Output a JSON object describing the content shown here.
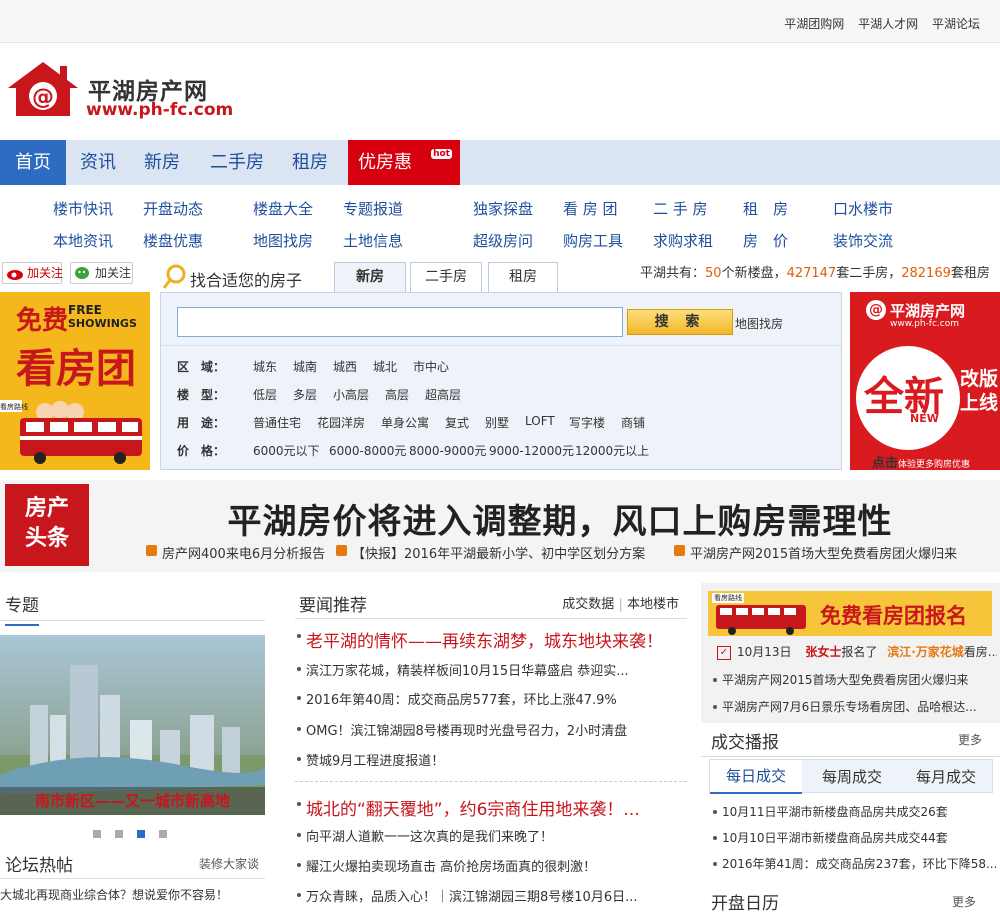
{
  "top_links": [
    "平湖团购网",
    "平湖人才网",
    "平湖论坛"
  ],
  "logo": {
    "name": "平湖房产网",
    "url": "www.ph-fc.com"
  },
  "nav": {
    "items": [
      "首页",
      "资讯",
      "新房",
      "二手房",
      "租房",
      "优房惠"
    ],
    "hot_badge": "hot"
  },
  "subnav": {
    "row1": [
      "楼市快讯",
      "开盘动态",
      "楼盘大全",
      "专题报道",
      "独家探盘",
      "看 房 团",
      "二 手 房",
      "租　房",
      "口水楼市"
    ],
    "row2": [
      "本地资讯",
      "楼盘优惠",
      "地图找房",
      "土地信息",
      "超级房问",
      "购房工具",
      "求购求租",
      "房　价",
      "装饰交流"
    ]
  },
  "social": {
    "weibo": "加关注",
    "wechat": "加关注"
  },
  "search": {
    "title": "找合适您的房子",
    "tabs": [
      "新房",
      "二手房",
      "租房"
    ],
    "button": "搜 索",
    "map_link": "地图找房",
    "placeholder": "",
    "filters": [
      {
        "label": "区　域：",
        "options": [
          "城东",
          "城南",
          "城西",
          "城北",
          "市中心"
        ]
      },
      {
        "label": "楼　型：",
        "options": [
          "低层",
          "多层",
          "小高层",
          "高层",
          "超高层"
        ]
      },
      {
        "label": "用　途：",
        "options": [
          "普通住宅",
          "花园洋房",
          "单身公寓",
          "复式",
          "别墅",
          "LOFT",
          "写字楼",
          "商铺"
        ]
      },
      {
        "label": "价　格：",
        "options": [
          "6000元以下",
          "6000-8000元",
          "8000-9000元",
          "9000-12000元",
          "12000元以上"
        ]
      }
    ]
  },
  "stats": {
    "prefix": "平湖共有：",
    "new_count": "50",
    "new_label": "个新楼盘，",
    "second_count": "427147",
    "second_label": "套二手房，",
    "rent_count": "282169",
    "rent_label": "套租房"
  },
  "left_ad": {
    "free": "免费",
    "free_en1": "FREE",
    "free_en2": "SHOWINGS",
    "title": "看房团",
    "sign": "看房路线"
  },
  "right_ad": {
    "brand": "平湖房产网",
    "url": "www.ph-fc.com",
    "new": "全新",
    "new_en": "NEW",
    "tag1": "改版",
    "tag2": "上线",
    "bottom_bold": "点击",
    "bottom": "体验更多购房优惠"
  },
  "headline": {
    "badge1": "房产",
    "badge2": "头条",
    "title": "平湖房价将进入调整期，风口上购房需理性",
    "links": [
      "房产网400来电6月分析报告",
      "【快报】2016年平湖最新小学、初中学区划分方案",
      "平湖房产网2015首场大型免费看房团火爆归来"
    ]
  },
  "topics": {
    "title": "专题",
    "caption": "南市新区——又一城市新高地",
    "dots": 4
  },
  "forum": {
    "title": "论坛热帖",
    "more": "装修大家谈",
    "items": [
      "大城北再现商业综合体？想说爱你不容易！"
    ]
  },
  "news": {
    "title": "要闻推荐",
    "tabs": [
      "成交数据",
      "本地楼市"
    ],
    "group1": {
      "headline": "老平湖的情怀——再续东湖梦，城东地块来袭！",
      "items": [
        "滨江万家花城，精装样板间10月15日华幕盛启 恭迎实...",
        "2016年第40周：成交商品房577套，环比上涨47.9%",
        "OMG！滨江锦湖园8号楼再现时光盘号召力，2小时清盘",
        "赞城9月工程进度报道！"
      ]
    },
    "group2": {
      "headline": "城北的“翻天覆地”，约6宗商住用地来袭！...",
      "items": [
        "向平湖人道歉一一这次真的是我们来晚了！",
        "耀江火爆拍卖现场直击 高价抢房场面真的很刺激！",
        "万众青睐，品质入心！｜滨江锦湖园三期8号楼10月6日..."
      ]
    }
  },
  "signup": {
    "banner": "免费看房团报名",
    "sign": "看房路线",
    "date": "10月13日",
    "person": "张女士",
    "action": "报名了",
    "project": "滨江·万家花城",
    "suffix": "看房...",
    "items": [
      "平湖房产网2015首场大型免费看房团火爆归来",
      "平湖房产网7月6日景乐专场看房团、品哈根达..."
    ]
  },
  "deals": {
    "title": "成交播报",
    "more": "更多",
    "tabs": [
      "每日成交",
      "每周成交",
      "每月成交"
    ],
    "items": [
      "10月11日平湖市新楼盘商品房共成交26套",
      "10月10日平湖市新楼盘商品房共成交44套",
      "2016年第41周：成交商品房237套，环比下降58...."
    ]
  },
  "calendar": {
    "title": "开盘日历",
    "more": "更多"
  },
  "colors": {
    "brand_red": "#c8161d",
    "nav_blue": "#2d6cc0",
    "link_blue": "#1e4f9c",
    "stat_orange": "#e55a0d"
  }
}
